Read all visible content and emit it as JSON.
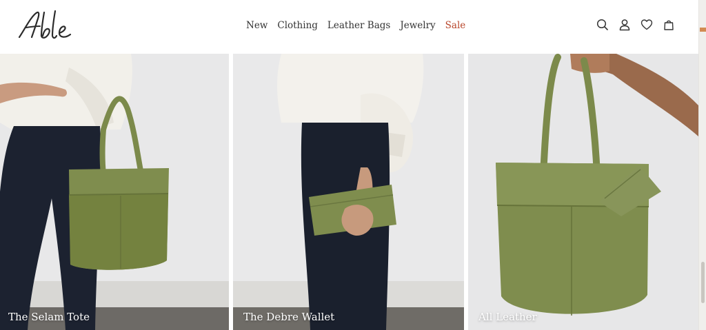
{
  "header": {
    "logo_text": "Able",
    "nav": [
      {
        "label": "New"
      },
      {
        "label": "Clothing"
      },
      {
        "label": "Leather Bags"
      },
      {
        "label": "Jewelry"
      },
      {
        "label": "Sale"
      }
    ],
    "icons": [
      "search-icon",
      "account-icon",
      "wishlist-heart-icon",
      "cart-bag-icon"
    ]
  },
  "colors": {
    "sale": "#b8452a",
    "nav_text": "#333333",
    "olive_leather": "#7f8d4e",
    "background": "#e9e9ea"
  },
  "tiles": [
    {
      "label": "The Selam Tote"
    },
    {
      "label": "The Debre Wallet"
    },
    {
      "label": "All Leather"
    }
  ]
}
